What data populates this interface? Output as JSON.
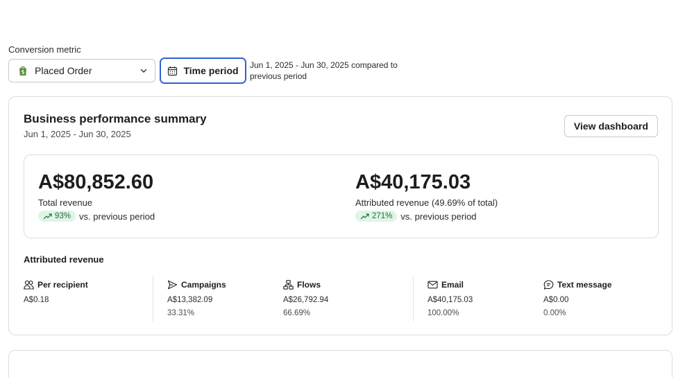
{
  "filters": {
    "conversion_metric_label": "Conversion metric",
    "conversion_metric_value": "Placed Order",
    "time_period_button": "Time period",
    "period_description": "Jun 1, 2025 - Jun 30, 2025 compared to previous period"
  },
  "summary": {
    "title": "Business performance summary",
    "date_range": "Jun 1, 2025 - Jun 30, 2025",
    "view_dashboard_button": "View dashboard",
    "total": {
      "amount": "A$80,852.60",
      "label": "Total revenue",
      "change": "93%",
      "change_suffix": "vs. previous period"
    },
    "attributed": {
      "amount": "A$40,175.03",
      "label": "Attributed revenue (49.69% of total)",
      "change": "271%",
      "change_suffix": "vs. previous period"
    }
  },
  "attributed_revenue": {
    "title": "Attributed revenue",
    "items": [
      {
        "label": "Per recipient",
        "icon": "people-icon",
        "value": "A$0.18",
        "percent": ""
      },
      {
        "label": "Campaigns",
        "icon": "send-icon",
        "value": "A$13,382.09",
        "percent": "33.31%"
      },
      {
        "label": "Flows",
        "icon": "flow-icon",
        "value": "A$26,792.94",
        "percent": "66.69%"
      },
      {
        "label": "Email",
        "icon": "mail-icon",
        "value": "A$40,175.03",
        "percent": "100.00%"
      },
      {
        "label": "Text message",
        "icon": "sms-icon",
        "value": "A$0.00",
        "percent": "0.00%"
      }
    ]
  },
  "colors": {
    "accent_focus": "#2b61d1",
    "positive_badge_bg": "#dff5e6",
    "positive_badge_text": "#1f6b3a",
    "shopify_green": "#5e8e3e"
  }
}
